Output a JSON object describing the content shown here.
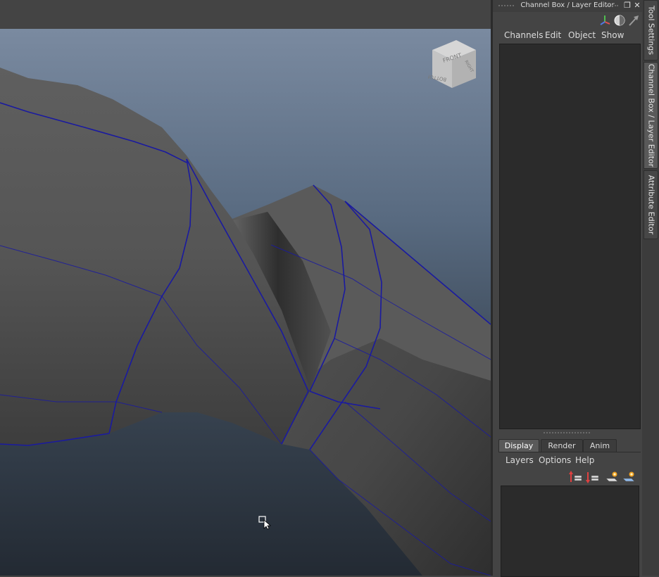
{
  "viewport": {
    "view_cube": {
      "face_front": "FRONT",
      "face_right": "RIGHT",
      "face_bottom": "BOTTOM"
    },
    "wireframe_color": "#1a1aa0",
    "mesh_color": "#5c5c5c"
  },
  "panel": {
    "title": "Channel Box / Layer Editor",
    "toolbar_icons": [
      "axes-icon",
      "shading-icon",
      "pointer-arrow-icon"
    ],
    "menus": [
      "Channels",
      "Edit",
      "Object",
      "Show"
    ],
    "layer_tabs": [
      {
        "label": "Display",
        "active": true
      },
      {
        "label": "Render",
        "active": false
      },
      {
        "label": "Anim",
        "active": false
      }
    ],
    "layer_menus": [
      "Layers",
      "Options",
      "Help"
    ],
    "layer_icons": [
      "move-layer-up-icon",
      "move-layer-down-icon",
      "new-layer-icon",
      "new-layer-selected-icon"
    ]
  },
  "side_tabs": [
    {
      "label": "Tool Settings",
      "active": false
    },
    {
      "label": "Channel Box / Layer Editor",
      "active": true
    },
    {
      "label": "Attribute Editor",
      "active": false
    }
  ],
  "colors": {
    "background": "#444444",
    "panel_field": "#2b2b2b",
    "accent_wire": "#1a1aa0"
  }
}
